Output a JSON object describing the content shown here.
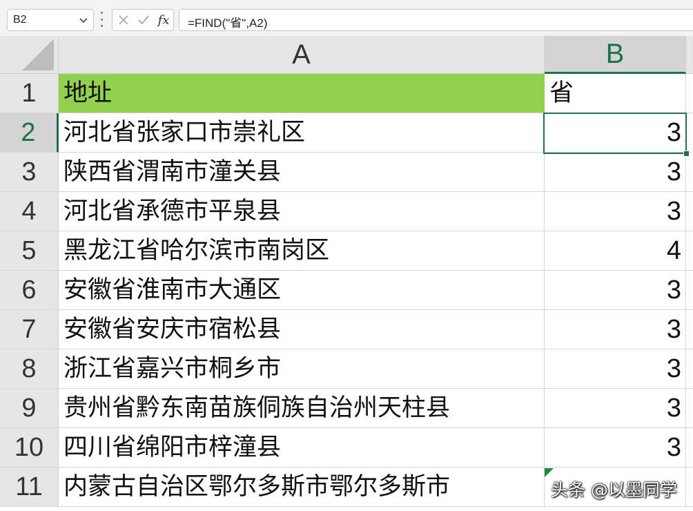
{
  "formula_bar": {
    "name_box": "B2",
    "fx_label": "fx",
    "formula": "=FIND(\"省\",A2)"
  },
  "column_headers": [
    "A",
    "B"
  ],
  "rows": [
    {
      "num": "1",
      "a": "地址",
      "b": "省"
    },
    {
      "num": "2",
      "a": "河北省张家口市崇礼区",
      "b": "3"
    },
    {
      "num": "3",
      "a": "陕西省渭南市潼关县",
      "b": "3"
    },
    {
      "num": "4",
      "a": "河北省承德市平泉县",
      "b": "3"
    },
    {
      "num": "5",
      "a": "黑龙江省哈尔滨市南岗区",
      "b": "4"
    },
    {
      "num": "6",
      "a": "安徽省淮南市大通区",
      "b": "3"
    },
    {
      "num": "7",
      "a": "安徽省安庆市宿松县",
      "b": "3"
    },
    {
      "num": "8",
      "a": "浙江省嘉兴市桐乡市",
      "b": "3"
    },
    {
      "num": "9",
      "a": "贵州省黔东南苗族侗族自治州天柱县",
      "b": "3"
    },
    {
      "num": "10",
      "a": "四川省绵阳市梓潼县",
      "b": "3"
    },
    {
      "num": "11",
      "a": "内蒙古自治区鄂尔多斯市鄂尔多斯市",
      "b": ""
    }
  ],
  "watermark": "头条 @以墨同学",
  "colors": {
    "header_fill": "#92d050",
    "accent": "#1e7145"
  }
}
